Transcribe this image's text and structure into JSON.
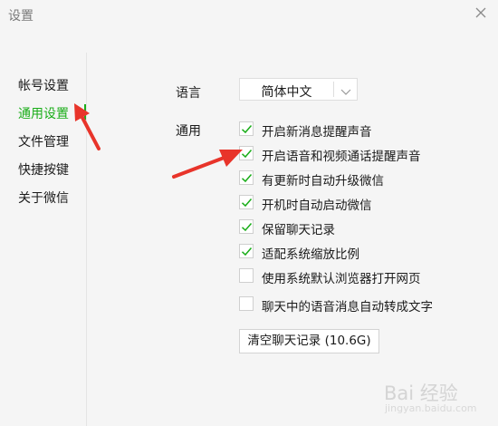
{
  "window": {
    "title": "设置"
  },
  "sidebar": {
    "items": [
      {
        "label": "帐号设置",
        "active": false
      },
      {
        "label": "通用设置",
        "active": true
      },
      {
        "label": "文件管理",
        "active": false
      },
      {
        "label": "快捷按键",
        "active": false
      },
      {
        "label": "关于微信",
        "active": false
      }
    ]
  },
  "language": {
    "label": "语言",
    "selected": "简体中文"
  },
  "general": {
    "label": "通用",
    "options": [
      {
        "label": "开启新消息提醒声音",
        "checked": true
      },
      {
        "label": "开启语音和视频通话提醒声音",
        "checked": true
      },
      {
        "label": "有更新时自动升级微信",
        "checked": true
      },
      {
        "label": "开机时自动启动微信",
        "checked": true
      },
      {
        "label": "保留聊天记录",
        "checked": true
      },
      {
        "label": "适配系统缩放比例",
        "checked": true
      },
      {
        "label": "使用系统默认浏览器打开网页",
        "checked": false
      },
      {
        "label": "聊天中的语音消息自动转成文字",
        "checked": false
      }
    ]
  },
  "clear_button": {
    "label": "清空聊天记录 (10.6G)"
  },
  "colors": {
    "accent": "#1aad19",
    "annotation": "#e8342a"
  },
  "icons": {
    "close": "close-icon",
    "dropdown": "chevron-down-icon",
    "check": "check-icon"
  },
  "watermark": {
    "text": "Bai 经验",
    "url": "jingyan.baidu.com"
  }
}
